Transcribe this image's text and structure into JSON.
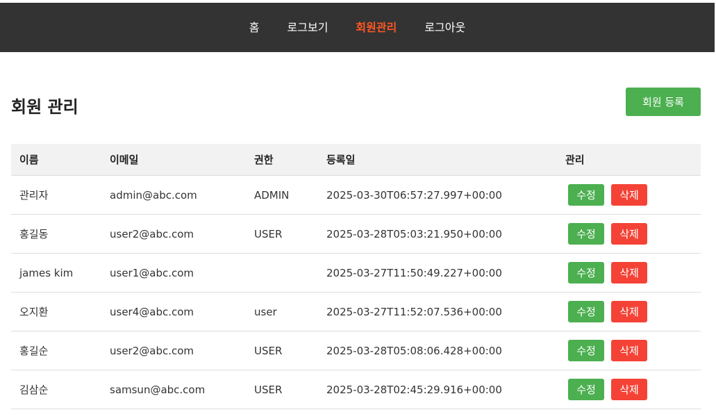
{
  "nav": {
    "items": [
      {
        "label": "홈",
        "active": false
      },
      {
        "label": "로그보기",
        "active": false
      },
      {
        "label": "회원관리",
        "active": true
      },
      {
        "label": "로그아웃",
        "active": false
      }
    ]
  },
  "page": {
    "title": "회원 관리",
    "add_button_label": "회원 등록"
  },
  "table": {
    "headers": [
      "이름",
      "이메일",
      "권한",
      "등록일",
      "관리"
    ],
    "edit_label": "수정",
    "delete_label": "삭제",
    "rows": [
      {
        "name": "관리자",
        "email": "admin@abc.com",
        "role": "ADMIN",
        "date": "2025-03-30T06:57:27.997+00:00"
      },
      {
        "name": "홍길동",
        "email": "user2@abc.com",
        "role": "USER",
        "date": "2025-03-28T05:03:21.950+00:00"
      },
      {
        "name": "james kim",
        "email": "user1@abc.com",
        "role": "",
        "date": "2025-03-27T11:50:49.227+00:00"
      },
      {
        "name": "오지환",
        "email": "user4@abc.com",
        "role": "user",
        "date": "2025-03-27T11:52:07.536+00:00"
      },
      {
        "name": "홍길순",
        "email": "user2@abc.com",
        "role": "USER",
        "date": "2025-03-28T05:08:06.428+00:00"
      },
      {
        "name": "김삼순",
        "email": "samsun@abc.com",
        "role": "USER",
        "date": "2025-03-28T02:45:29.916+00:00"
      }
    ]
  },
  "colors": {
    "nav_bg": "#333333",
    "nav_active": "#ff5722",
    "success": "#4caf50",
    "danger": "#f44336",
    "header_bg": "#f2f2f2"
  }
}
